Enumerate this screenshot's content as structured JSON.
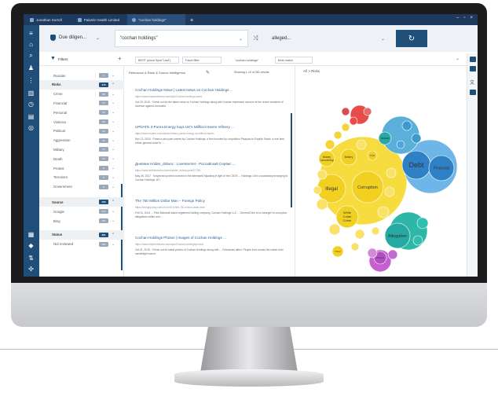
{
  "titlebar": {
    "user": "Jonathan Sorrell",
    "org": "Palantir Health Limited",
    "tab": "\"cochan holdings\"",
    "add_tab": "+",
    "controls": [
      "–",
      "▫",
      "×"
    ]
  },
  "search": {
    "profile": "Due diligen...",
    "query": "\"cochan holdings\"",
    "topic": "alleged...",
    "go_icon": "refresh-icon"
  },
  "filters": {
    "label": "Filters",
    "add": "+",
    "date_sel": "BEST (since 5yrs/\"Last\")",
    "facet_sel": "Facet filter",
    "hold_sel": "\"cochan holdings\"",
    "match_sel": "Best match"
  },
  "sidebar": {
    "rows": [
      {
        "label": "Russian",
        "count": "9",
        "type": "sub"
      },
      {
        "label": "Risks",
        "count": "176",
        "type": "sec"
      },
      {
        "label": "Crime",
        "count": "98",
        "type": "sub"
      },
      {
        "label": "Financial",
        "count": "74",
        "type": "sub"
      },
      {
        "label": "Personal",
        "count": "52",
        "type": "sub"
      },
      {
        "label": "Violence",
        "count": "40",
        "type": "sub"
      },
      {
        "label": "Political",
        "count": "33",
        "type": "sub"
      },
      {
        "label": "Aggression",
        "count": "21",
        "type": "sub"
      },
      {
        "label": "Military",
        "count": "17",
        "type": "sub"
      },
      {
        "label": "Death",
        "count": "12",
        "type": "sub"
      },
      {
        "label": "Protest",
        "count": "9",
        "type": "sub"
      },
      {
        "label": "Terrorism",
        "count": "6",
        "type": "sub"
      },
      {
        "label": "Government",
        "count": "5",
        "type": "sub"
      },
      {
        "label": "Source",
        "count": "463",
        "type": "sec"
      },
      {
        "label": "Google",
        "count": "312",
        "type": "sub"
      },
      {
        "label": "Bing",
        "count": "151",
        "type": "sub"
      },
      {
        "label": "Status",
        "count": "381",
        "type": "sec"
      },
      {
        "label": "Not reviewed",
        "count": "381",
        "type": "sub"
      }
    ]
  },
  "results": {
    "sort": "Relevance & Rank & Source Intelligence",
    "count": "Showing 1-10 of 381 results",
    "items": [
      {
        "title": "Cochan Holdings News | Latest News on Cochan Holdings ...",
        "url": "https://www.theprimetimes.com/topic/Cochan-holdings-news",
        "snippet": "Oct 19, 2015 · Check out for the latest news on Cochan Holdings along with Cochan expressed concern at the recent incidents of violence against Journalist."
      },
      {
        "title": "UPDATE 3-Purea Energy buys UK's Millford Haven refinery ...",
        "url": "https://www.reuters.com/article/refinery-purea-energy-uk-millford-haven",
        "snippet": "Nov 13, 2015 · Purea is also part-owned by Cochan Holdings, a firm founded by Leopoldino Pisapaa do Espirito Santo, a one-time ethnic general close to ..."
      },
      {
        "title": "Дневник Holder_dslwoc : LiveInternet - Российский Сервис ...",
        "url": "https://www.liveinternet.ru/users/holder_dslwoc/post377281",
        "snippet": "May 26, 2017 · Suspected probes involved in the attempted hijacking in light of the CEOS ... Holdings Ltd is a subsidiary belonging to Cochan Holdings. ATI"
      },
      {
        "title": "The 750 Million Dollar Man – Foreign Policy",
        "url": "https://foreignpolicy.com/2014/02/11/the-750-million-dollar-man",
        "snippet": "Feb 11, 2014 ... Pia's Marshall Island-registered holding company, Cochan Holdings LLC ... General Dino is no stranger to corruption allegations within and ..."
      },
      {
        "title": "Cochan Holdings Photos | Images of Cochan Holdings ...",
        "url": "https://www.theprimetimes.com/topic/Cochan-holdings/photos",
        "snippet": "Oct 21, 2015 · Check out for latest photos of Cochan Holdings along with ... Fotoramas affect. People from across the nation bold candlelight march."
      }
    ]
  },
  "chart": {
    "header": "All > Risks",
    "bubbles": [
      {
        "label": "Debt",
        "color": "#2f80c4"
      },
      {
        "label": "Financial",
        "color": "#2f80c4"
      },
      {
        "label": "Illegal",
        "color": "#f2d022"
      },
      {
        "label": "Corruption",
        "color": "#f2d022"
      },
      {
        "label": "White Collar Crime",
        "color": "#f2d022"
      },
      {
        "label": "Money Laundering",
        "color": "#f2d022"
      },
      {
        "label": "Bribery",
        "color": "#f2d022"
      },
      {
        "label": "Theft",
        "color": "#f2d022"
      },
      {
        "label": "Fraud",
        "color": "#f2d022"
      },
      {
        "label": "Allegation",
        "color": "#27a9a3"
      },
      {
        "label": "Assault",
        "color": "#27a9a3"
      },
      {
        "label": "Protest",
        "color": "#b04fc0"
      }
    ]
  }
}
